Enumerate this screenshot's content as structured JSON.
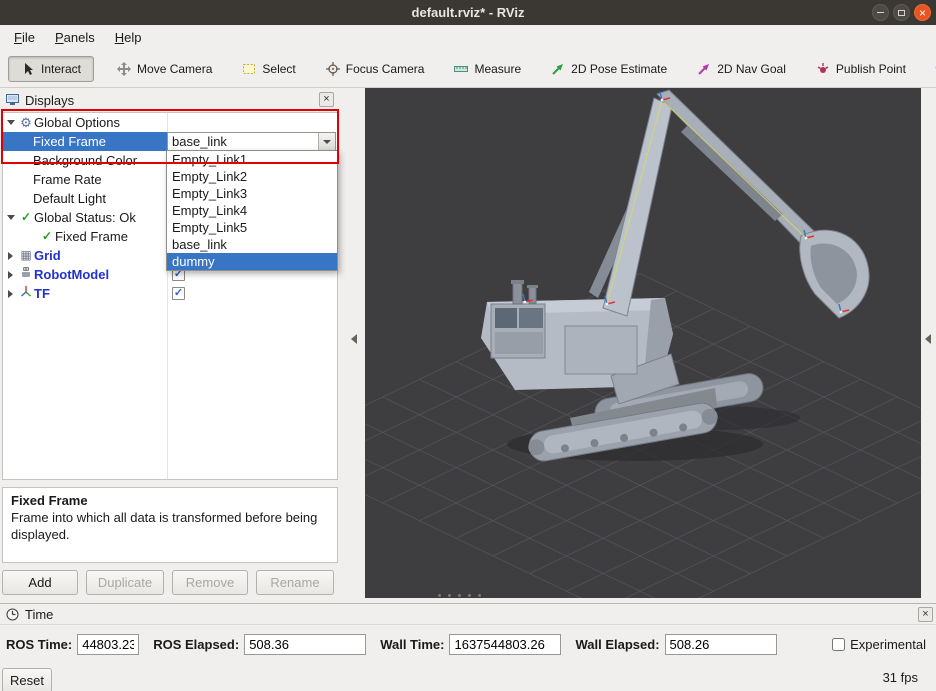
{
  "window": {
    "title": "default.rviz* - RViz",
    "close_glyph": "×"
  },
  "menu": {
    "items": [
      "File",
      "Panels",
      "Help"
    ]
  },
  "toolbar": {
    "buttons": [
      "Interact",
      "Move Camera",
      "Select",
      "Focus Camera",
      "Measure",
      "2D Pose Estimate",
      "2D Nav Goal",
      "Publish Point"
    ],
    "add_tool_glyph": "+",
    "overflow_glyph": "»"
  },
  "displays": {
    "title": "Displays",
    "close_glyph": "×",
    "rows": {
      "global_options": "Global Options",
      "fixed_frame": "Fixed Frame",
      "background_color": "Background Color",
      "frame_rate": "Frame Rate",
      "default_light": "Default Light",
      "global_status": "Global Status: Ok",
      "status_fixed_frame": "Fixed Frame",
      "grid": "Grid",
      "robot_model": "RobotModel",
      "tf": "TF"
    },
    "fixed_frame_value": "base_link",
    "dropdown": {
      "options": [
        "Empty_Link1",
        "Empty_Link2",
        "Empty_Link3",
        "Empty_Link4",
        "Empty_Link5",
        "base_link",
        "dummy"
      ],
      "selected": "dummy"
    },
    "help": {
      "title": "Fixed Frame",
      "body": "Frame into which all data is transformed before being displayed."
    },
    "buttons": {
      "add": "Add",
      "duplicate": "Duplicate",
      "remove": "Remove",
      "rename": "Rename"
    }
  },
  "time_panel": {
    "title": "Time",
    "close_glyph": "×",
    "fields": [
      {
        "label": "ROS Time:",
        "value": "44803.23"
      },
      {
        "label": "ROS Elapsed:",
        "value": "508.36"
      },
      {
        "label": "Wall Time:",
        "value": "1637544803.26"
      },
      {
        "label": "Wall Elapsed:",
        "value": "508.26"
      }
    ],
    "experimental_label": "Experimental",
    "fps": "31 fps",
    "reset_label": "Reset"
  },
  "colors": {
    "selection": "#3875c5",
    "annotation": "#e00000",
    "viewport_bg": "#3e3e41"
  }
}
